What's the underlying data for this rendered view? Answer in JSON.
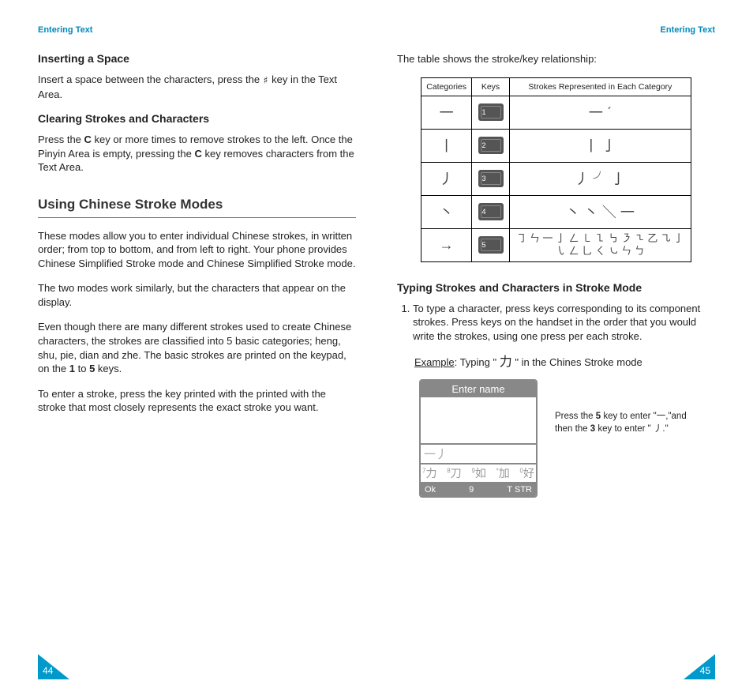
{
  "headers": {
    "left": "Entering Text",
    "right": "Entering Text"
  },
  "pageNumbers": {
    "left": "44",
    "right": "45"
  },
  "left": {
    "h_space": "Inserting a Space",
    "p_space_a": "Insert a space between the characters, press the ",
    "p_space_glyph": "♯",
    "p_space_b": " key in the Text Area.",
    "h_clear": "Clearing Strokes and Characters",
    "p_clear_a": "Press the ",
    "p_clear_b": " key or more times to remove strokes to the left. Once the Pinyin Area is empty, pressing the ",
    "p_clear_c": " key removes characters from the Text Area.",
    "c_key": "C",
    "h_major": "Using Chinese Stroke Modes",
    "p1": "These modes allow you to enter individual Chinese strokes, in written order; from top to bottom, and from left to right. Your phone provides Chinese Simplified Stroke mode and Chinese Simplified Stroke mode.",
    "p2": "The two modes work similarly, but the characters that appear on the display.",
    "p3_a": "Even though there are many different strokes used to create Chinese characters, the strokes are classified into 5 basic categories; heng, shu, pie, dian and zhe. The basic strokes are printed on the keypad, on the ",
    "p3_b": " to ",
    "p3_c": " keys.",
    "key1": "1",
    "key5": "5",
    "p4": "To enter a stroke, press the key printed with the printed with the stroke that most closely represents the exact stroke you want."
  },
  "right": {
    "intro": "The table shows the stroke/key relationship:",
    "th1": "Categories",
    "th2": "Keys",
    "th3": "Strokes Represented in Each Category",
    "rows": [
      {
        "cat": "一",
        "key": "1",
        "rep": "一  ˊ"
      },
      {
        "cat": "丨",
        "key": "2",
        "rep": "丨  亅"
      },
      {
        "cat": "丿",
        "key": "3",
        "rep": "丿  ╯ 亅"
      },
      {
        "cat": "丶",
        "key": "4",
        "rep": "丶 丶 ＼ 一"
      },
      {
        "cat": "→",
        "key": "5",
        "rep": "㇆ ㄣ 一 亅 ㄥ ㇄ ㇅ ㇉ ㇋ ㇍\n乙 ㇈ 亅 ㇂ ㄥ 乚 ㄑ ㇃ ㄣ ㄅ"
      }
    ],
    "h_typing": "Typing Strokes and Characters in Stroke Mode",
    "li1": "To type a character, press keys corresponding to its component strokes. Press keys on the handset in the order that you would write the strokes, using one press per each stroke.",
    "example_label": "Example",
    "example_a": ": Typing \" ",
    "example_char": "力",
    "example_b": " \" in the Chines Stroke mode",
    "phone": {
      "title": "Enter name",
      "strokes": "一丿",
      "candidates": [
        {
          "n": "7",
          "c": "力"
        },
        {
          "n": "8",
          "c": "刀"
        },
        {
          "n": "9",
          "c": "如"
        },
        {
          "n": "*",
          "c": "加"
        },
        {
          "n": "0",
          "c": "好"
        }
      ],
      "sk_left": "Ok",
      "sk_mid": "9",
      "sk_right": "T STR"
    },
    "note_a": "Press the ",
    "note_key5": "5",
    "note_b": " key to enter \"一,\"and then the ",
    "note_key3": "3",
    "note_c": " key to enter \" 丿.\""
  }
}
